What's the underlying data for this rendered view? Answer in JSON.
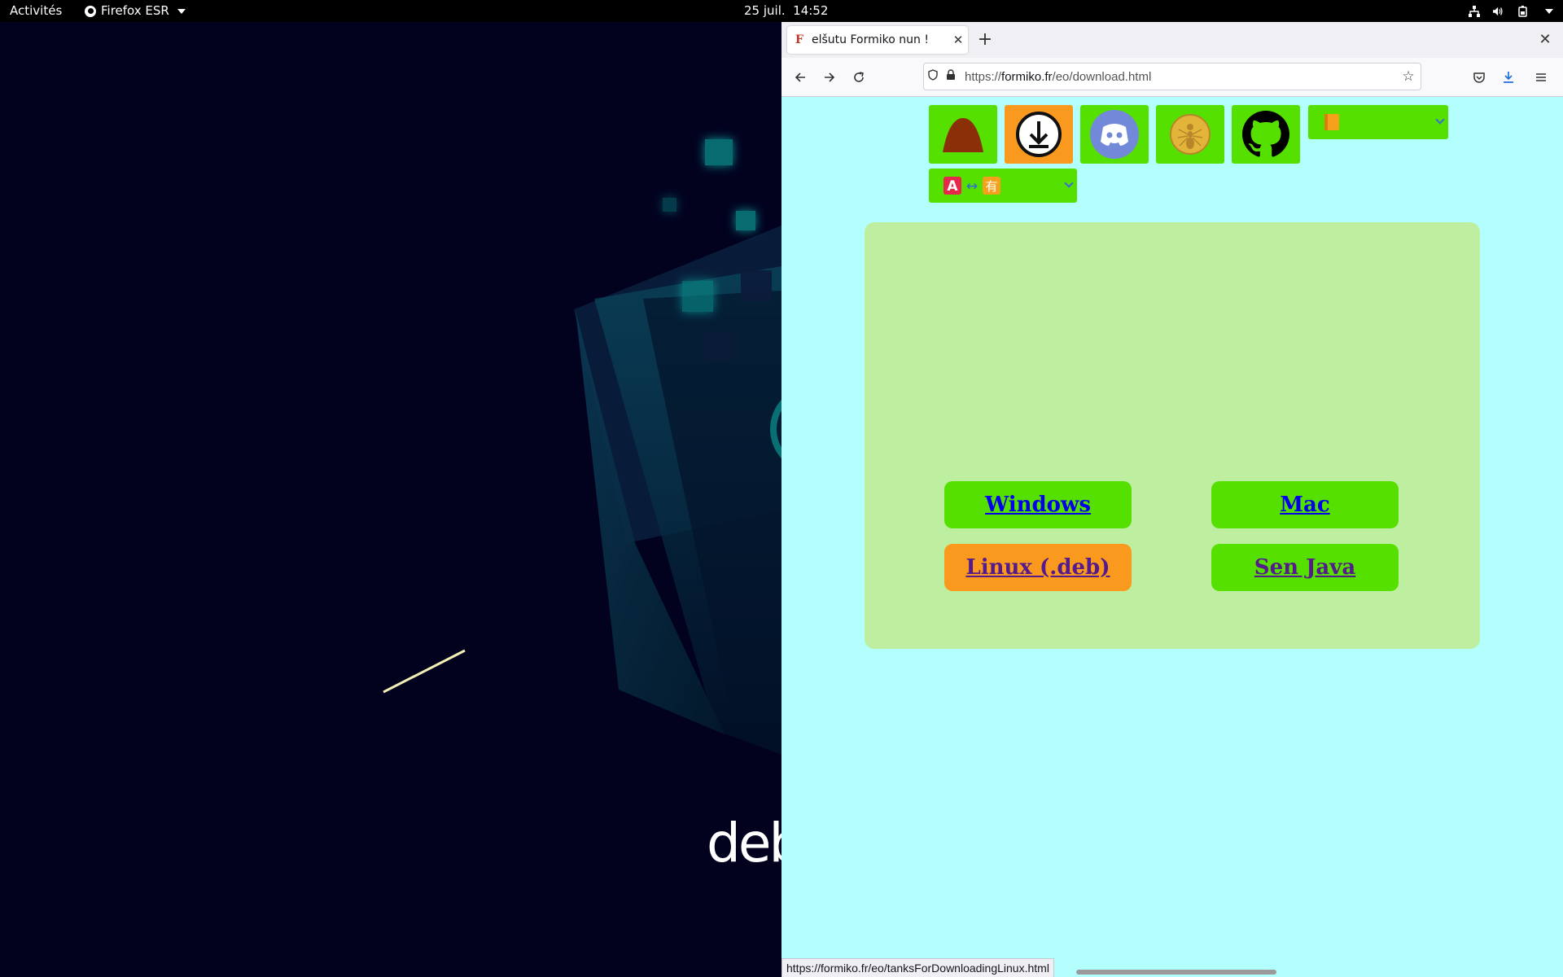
{
  "topbar": {
    "activities": "Activités",
    "app_name": "Firefox ESR",
    "clock": "25 juil.  14:52",
    "tray_icons": [
      "network-icon",
      "volume-icon",
      "battery-icon",
      "system-menu-icon"
    ]
  },
  "desktop": {
    "wallpaper_text": "deb"
  },
  "browser": {
    "tab_title": "elšutu Formiko nun !",
    "tab_favicon": "F",
    "new_tab": "+",
    "close_window": "✕",
    "url_prefix": "https://",
    "url_domain": "formiko.fr",
    "url_path": "/eo/download.html",
    "status_url": "https://formiko.fr/eo/tanksForDownloadingLinux.html"
  },
  "page": {
    "nav_tiles": [
      "anthill-icon",
      "download-icon",
      "discord-icon",
      "ant-emblem-icon",
      "github-icon"
    ],
    "theme_select_value": "",
    "lang_select_value": "",
    "downloads": {
      "windows": "Windows",
      "mac": "Mac",
      "linux": "Linux (.deb)",
      "no_java": "Sen Java"
    }
  },
  "colors": {
    "page_bg": "#b3fffd",
    "tile_green": "#55e000",
    "tile_orange": "#f99a1f",
    "panel_green": "#beee9f"
  }
}
